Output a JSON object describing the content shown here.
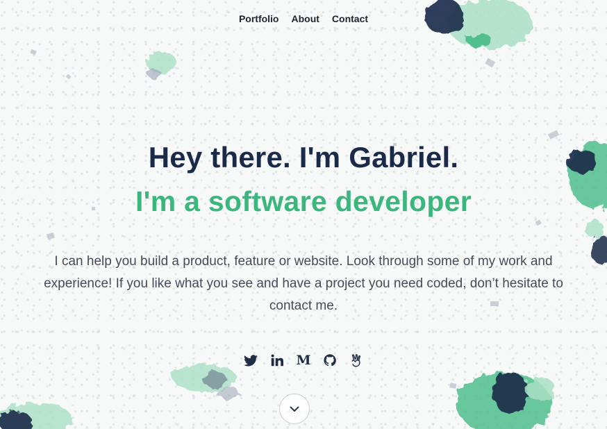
{
  "nav": {
    "items": [
      {
        "label": "Portfolio"
      },
      {
        "label": "About"
      },
      {
        "label": "Contact"
      }
    ]
  },
  "hero": {
    "greeting": "Hey there. I'm Gabriel.",
    "role": "I'm a software developer",
    "intro_lines": [
      "I can help you build a product, feature or website. Look through some of my work and",
      "experience! If you like what you see and have a project you need coded, don’t hesitate to",
      "contact me."
    ]
  },
  "social": {
    "icons": [
      "twitter-icon",
      "linkedin-icon",
      "medium-icon",
      "github-icon",
      "angellist-icon"
    ],
    "medium_glyph": "M"
  },
  "scroll_down": {
    "icon": "chevron-down-icon"
  },
  "colors": {
    "heading": "#1b2a49",
    "accent": "#3bb77e",
    "body_text": "#454b57",
    "navy_decor": "#1b2a49",
    "mint_decor": "#a9dfc6"
  }
}
